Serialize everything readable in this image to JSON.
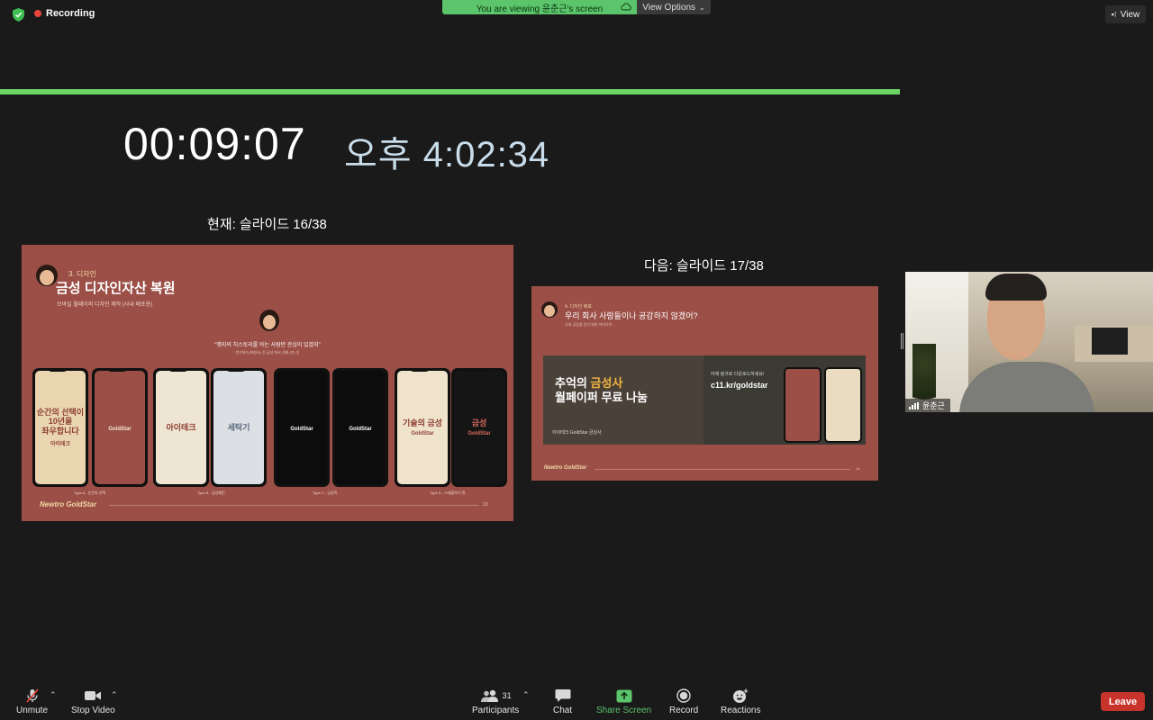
{
  "top": {
    "recording_label": "Recording",
    "viewing_label": "You are viewing 윤춘근's screen",
    "view_options_label": "View Options",
    "view_label": "View"
  },
  "presenter": {
    "elapsed_time": "00:09:07",
    "clock": "오후 4:02:34",
    "current_slide_label": "현재: 슬라이드 16/38",
    "next_slide_label": "다음: 슬라이드 17/38",
    "progress_fraction": 0.42
  },
  "current_slide": {
    "section": "3. 디자인",
    "title": "금성 디자인자산 복원",
    "subtitle": "모바일 월페이퍼 디자인 제작 (사내 배포용)",
    "quote": "\"옛지의 히스토리를 아는 사람만 관심이 있겠지\"",
    "quote_sub": "반가워드(회원사) 전 금성 에서 선배 (만) 인",
    "phones": [
      {
        "text": "순간의 선택이\n10년을\n좌우합니다",
        "logo": "아이테크",
        "bg": "#e9d6b0",
        "fg": "#8e3d33"
      },
      {
        "text": "",
        "logo": "GoldStar",
        "bg": "#9b4f47",
        "fg": "#f3e6cf"
      },
      {
        "text": "아이테크",
        "logo": "",
        "bg": "#efe5d3",
        "fg": "#8e3d33"
      },
      {
        "text": "세탁기",
        "logo": "",
        "bg": "#dcdfe4",
        "fg": "#5a6a7a"
      },
      {
        "text": "",
        "logo": "GoldStar",
        "bg": "#0c0c0c",
        "fg": "#ffffff"
      },
      {
        "text": "",
        "logo": "GoldStar",
        "bg": "#0c0c0c",
        "fg": "#ffffff"
      },
      {
        "text": "기술의 금성",
        "logo": "GoldStar",
        "bg": "#efe3cc",
        "fg": "#8e3d33"
      },
      {
        "text": "금성",
        "logo": "GoldStar",
        "bg": "#151515",
        "fg": "#d66a5c"
      }
    ],
    "type_labels": [
      "Type A - 순간의 선택",
      "Type B - 금성패턴",
      "Type C - 금성목",
      "Type D - 스테플하기 편"
    ],
    "footer_brand": "Newtro GoldStar",
    "page_number": "13"
  },
  "next_slide": {
    "section": "4. 디자인 배포",
    "title": "우리 회사 사람들이나 공감하지 않겠어?",
    "subtitle": "사내 공감을 얻기 위한 아이디어",
    "banner_headline_1": "추억의 ",
    "banner_headline_1_highlight": "금성사",
    "banner_headline_2": "월페이퍼 무료 나눔",
    "banner_strip": "아이테크 GoldStar 금성사",
    "banner_url_label": "아래 링크로 다운로드하세요!",
    "banner_url": "c11.kr/goldstar",
    "footer_brand": "Newtro GoldStar",
    "page_number": "14"
  },
  "participant": {
    "name": "윤춘근"
  },
  "toolbar": {
    "unmute": "Unmute",
    "stop_video": "Stop Video",
    "participants": "Participants",
    "participants_count": "31",
    "chat": "Chat",
    "share_screen": "Share Screen",
    "record": "Record",
    "reactions": "Reactions",
    "leave": "Leave"
  },
  "colors": {
    "accent_green": "#5cc46a",
    "slide_bg": "#9b4f47",
    "leave_red": "#c8332c"
  }
}
